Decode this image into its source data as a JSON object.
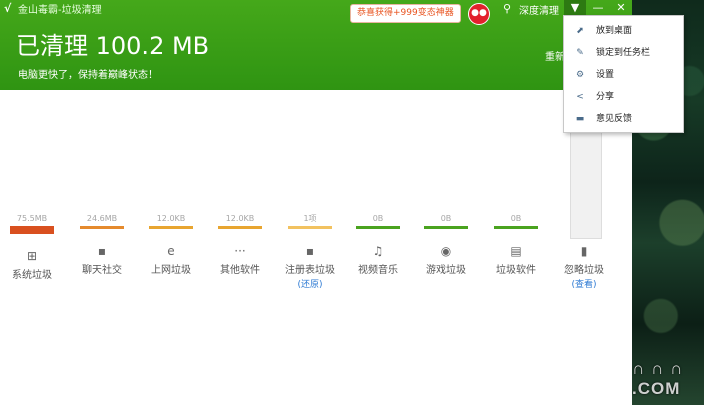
{
  "app": {
    "title": "金山毒霸-垃圾清理",
    "logo": "√"
  },
  "header": {
    "promo": "恭喜获得+999变态神器",
    "deep_clean": "深度清理",
    "cleaned": "已清理 100.2 MB",
    "subtitle": "电脑更快了，保持着巅峰状态！",
    "rescan": "重新"
  },
  "window_buttons": {
    "menu": "▼",
    "min": "—",
    "close": "✕"
  },
  "menu": {
    "items": [
      {
        "label": "放到桌面",
        "icon": "upload-icon"
      },
      {
        "label": "锁定到任务栏",
        "icon": "pin-icon"
      },
      {
        "label": "设置",
        "icon": "gear-icon"
      },
      {
        "label": "分享",
        "icon": "share-icon"
      },
      {
        "label": "意见反馈",
        "icon": "chat-icon"
      }
    ]
  },
  "categories": [
    {
      "size": "75.5MB",
      "label": "系统垃圾",
      "icon": "windows-icon",
      "color": "#d9501f",
      "link": ""
    },
    {
      "size": "24.6MB",
      "label": "聊天社交",
      "icon": "chat-icon",
      "color": "#e58a2d",
      "link": ""
    },
    {
      "size": "12.0KB",
      "label": "上网垃圾",
      "icon": "ie-icon",
      "color": "#e8a530",
      "link": ""
    },
    {
      "size": "12.0KB",
      "label": "其他软件",
      "icon": "dots-icon",
      "color": "#e8a530",
      "link": ""
    },
    {
      "size": "1项",
      "label": "注册表垃圾",
      "icon": "registry-icon",
      "color": "#f2c260",
      "link": "(还原)"
    },
    {
      "size": "0B",
      "label": "视频音乐",
      "icon": "music-icon",
      "color": "#4aa31f",
      "link": ""
    },
    {
      "size": "0B",
      "label": "游戏垃圾",
      "icon": "gamepad-icon",
      "color": "#4aa31f",
      "link": ""
    },
    {
      "size": "0B",
      "label": "垃圾软件",
      "icon": "package-icon",
      "color": "#4aa31f",
      "link": ""
    },
    {
      "size": "",
      "label": "忽略垃圾",
      "icon": "trash-icon",
      "color": "",
      "link": "(查看)"
    }
  ],
  "watermark": "∩ ∩ ∩ .COM"
}
